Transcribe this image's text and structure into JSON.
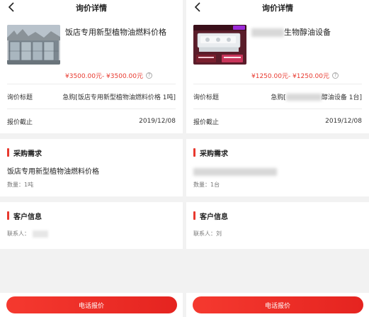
{
  "left": {
    "nav_title": "询价详情",
    "product_name": "饭店专用新型植物油燃料价格",
    "price": "¥3500.00元- ¥3500.00元",
    "inquiry_title_label": "询价标题",
    "inquiry_title_value": "急购[饭店专用新型植物油燃料价格 1吨]",
    "deadline_label": "报价截止",
    "deadline_value": "2019/12/08",
    "purchase_header": "采购需求",
    "purchase_text": "饭店专用新型植物油燃料价格",
    "quantity": "数量：1吨",
    "customer_header": "客户信息",
    "contact_label": "联系人：",
    "button_label": "电话报价"
  },
  "right": {
    "nav_title": "询价详情",
    "product_name_tail": "生物醇油设备",
    "price": "¥1250.00元- ¥1250.00元",
    "inquiry_title_label": "询价标题",
    "inquiry_title_prefix": "急购[",
    "inquiry_title_suffix": "醇油设备 1台]",
    "deadline_label": "报价截止",
    "deadline_value": "2019/12/08",
    "purchase_header": "采购需求",
    "quantity": "数量：1台",
    "customer_header": "客户信息",
    "contact_label": "联系人：刘",
    "button_label": "电话报价"
  },
  "colors": {
    "accent": "#e8392f",
    "background": "#f2f2f2"
  },
  "icons": {
    "back": "chevron-left-icon",
    "help": "question-circle-icon"
  }
}
